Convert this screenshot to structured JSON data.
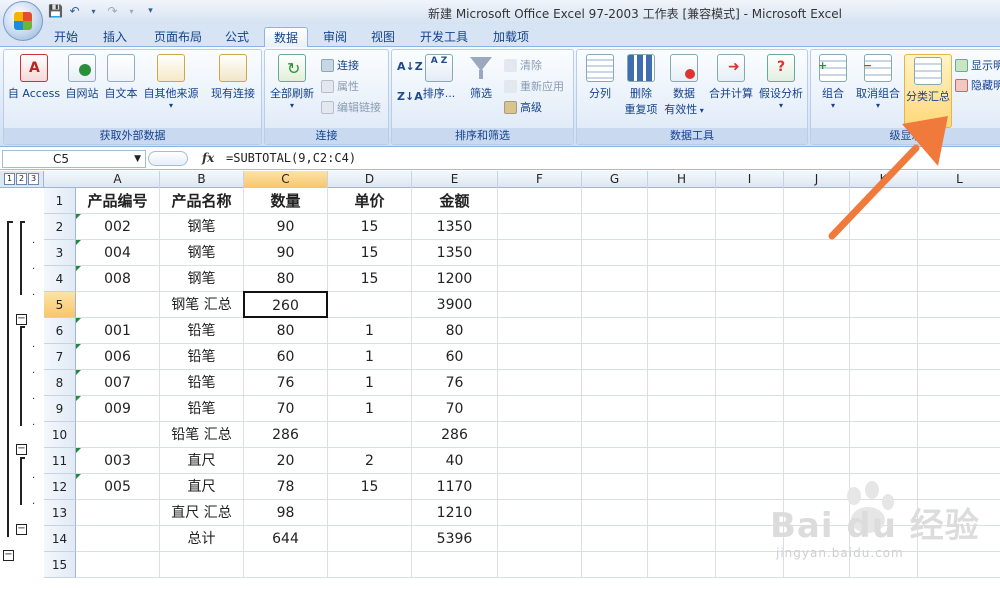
{
  "window": {
    "title": "新建 Microsoft Office Excel 97-2003 工作表  [兼容模式] - Microsoft Excel"
  },
  "tabs": [
    {
      "label": "开始"
    },
    {
      "label": "插入"
    },
    {
      "label": "页面布局"
    },
    {
      "label": "公式"
    },
    {
      "label": "数据",
      "active": true
    },
    {
      "label": "审阅"
    },
    {
      "label": "视图"
    },
    {
      "label": "开发工具"
    },
    {
      "label": "加载项"
    }
  ],
  "ribbon": {
    "get_external": {
      "label": "获取外部数据",
      "access": "自 Access",
      "web": "自网站",
      "text": "自文本",
      "other": "自其他来源",
      "existing": "现有连接"
    },
    "connections": {
      "label": "连接",
      "refresh_all": "全部刷新",
      "connections": "连接",
      "properties": "属性",
      "edit_links": "编辑链接"
    },
    "sort_filter": {
      "label": "排序和筛选",
      "sort": "排序...",
      "filter": "筛选",
      "clear": "清除",
      "reapply": "重新应用",
      "advanced": "高级"
    },
    "data_tools": {
      "label": "数据工具",
      "text_to_columns": "分列",
      "remove_dup_1": "删除",
      "remove_dup_2": "重复项",
      "validation_1": "数据",
      "validation_2": "有效性",
      "consolidate": "合并计算",
      "what_if": "假设分析"
    },
    "outline": {
      "label": "级显示",
      "group": "组合",
      "ungroup": "取消组合",
      "subtotal": "分类汇总",
      "show_detail": "显示明",
      "hide_detail": "隐藏明"
    }
  },
  "formula_bar": {
    "name_box": "C5",
    "fx": "fx",
    "formula": "=SUBTOTAL(9,C2:C4)"
  },
  "outline_levels": [
    "1",
    "2",
    "3"
  ],
  "columns": [
    "A",
    "B",
    "C",
    "D",
    "E",
    "F",
    "G",
    "H",
    "I",
    "J",
    "K",
    "L"
  ],
  "rows": [
    "1",
    "2",
    "3",
    "4",
    "5",
    "6",
    "7",
    "8",
    "9",
    "10",
    "11",
    "12",
    "13",
    "14",
    "15"
  ],
  "table": [
    [
      "产品编号",
      "产品名称",
      "数量",
      "单价",
      "金额"
    ],
    [
      "002",
      "钢笔",
      "90",
      "15",
      "1350"
    ],
    [
      "004",
      "钢笔",
      "90",
      "15",
      "1350"
    ],
    [
      "008",
      "钢笔",
      "80",
      "15",
      "1200"
    ],
    [
      "",
      "钢笔 汇总",
      "260",
      "",
      "3900"
    ],
    [
      "001",
      "铅笔",
      "80",
      "1",
      "80"
    ],
    [
      "006",
      "铅笔",
      "60",
      "1",
      "60"
    ],
    [
      "007",
      "铅笔",
      "76",
      "1",
      "76"
    ],
    [
      "009",
      "铅笔",
      "70",
      "1",
      "70"
    ],
    [
      "",
      "铅笔 汇总",
      "286",
      "",
      "286"
    ],
    [
      "003",
      "直尺",
      "20",
      "2",
      "40"
    ],
    [
      "005",
      "直尺",
      "78",
      "15",
      "1170"
    ],
    [
      "",
      "直尺 汇总",
      "98",
      "",
      "1210"
    ],
    [
      "",
      "总计",
      "644",
      "",
      "5396"
    ],
    [
      "",
      "",
      "",
      "",
      ""
    ]
  ],
  "active_cell": "C5",
  "watermark": {
    "brand": "Bai du 经验",
    "url": "jingyan.baidu.com"
  },
  "colors": {
    "accent": "#15428b",
    "arrow": "#f07a3c",
    "selection": "#f8c66b"
  }
}
